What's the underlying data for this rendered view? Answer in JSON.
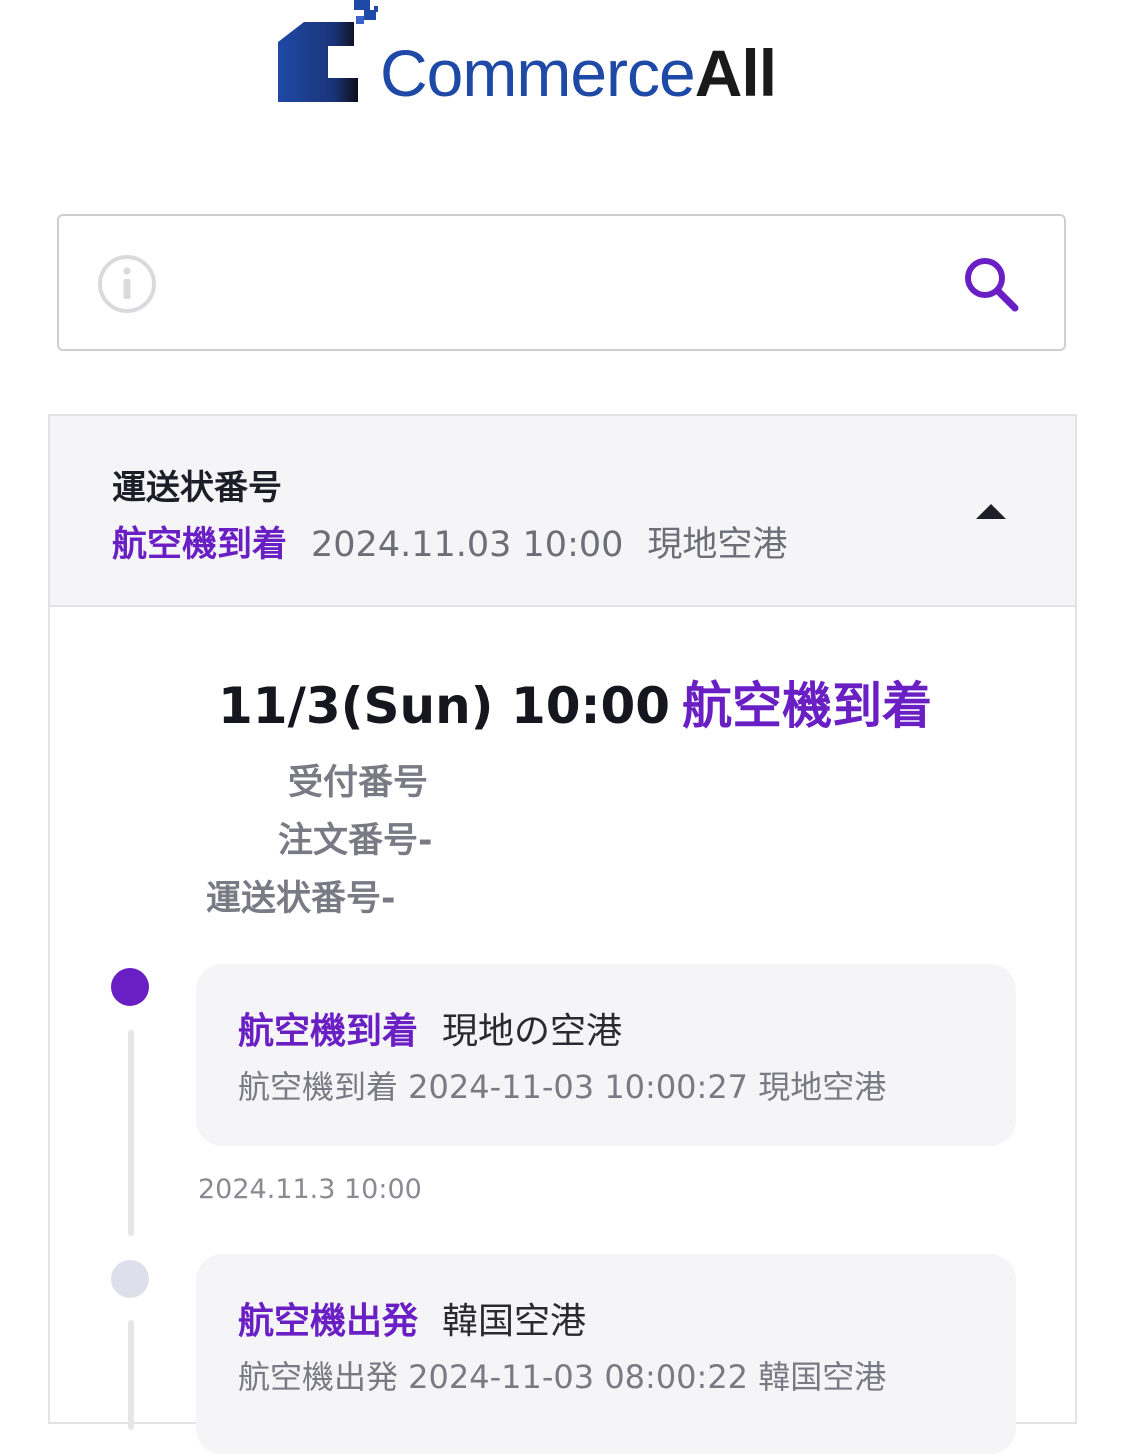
{
  "brand": {
    "commerce": "Commerce",
    "all": "All",
    "colors": {
      "blue": "#1f49a6",
      "dark": "#1a1a1a"
    }
  },
  "search": {
    "value": "",
    "placeholder": ""
  },
  "tracking": {
    "label": "運送状番号",
    "status": "航空機到着",
    "datetime": "2024.11.03 10:00",
    "location": "現地空港",
    "accent": "#6a1fc4"
  },
  "detail": {
    "datetime": "11/3(Sun) 10:00",
    "status": "航空機到着",
    "reception_label": "受付番号",
    "order_label": "注文番号-",
    "waybill_label": "運送状番号-"
  },
  "events": [
    {
      "status": "航空機到着",
      "location": "現地の空港",
      "description": "航空機到着 2024-11-03 10:00:27 現地空港",
      "time": "2024.11.3 10:00",
      "active": true
    },
    {
      "status": "航空機出発",
      "location": "韓国空港",
      "description": "航空機出発 2024-11-03 08:00:22 韓国空港",
      "active": false
    }
  ]
}
